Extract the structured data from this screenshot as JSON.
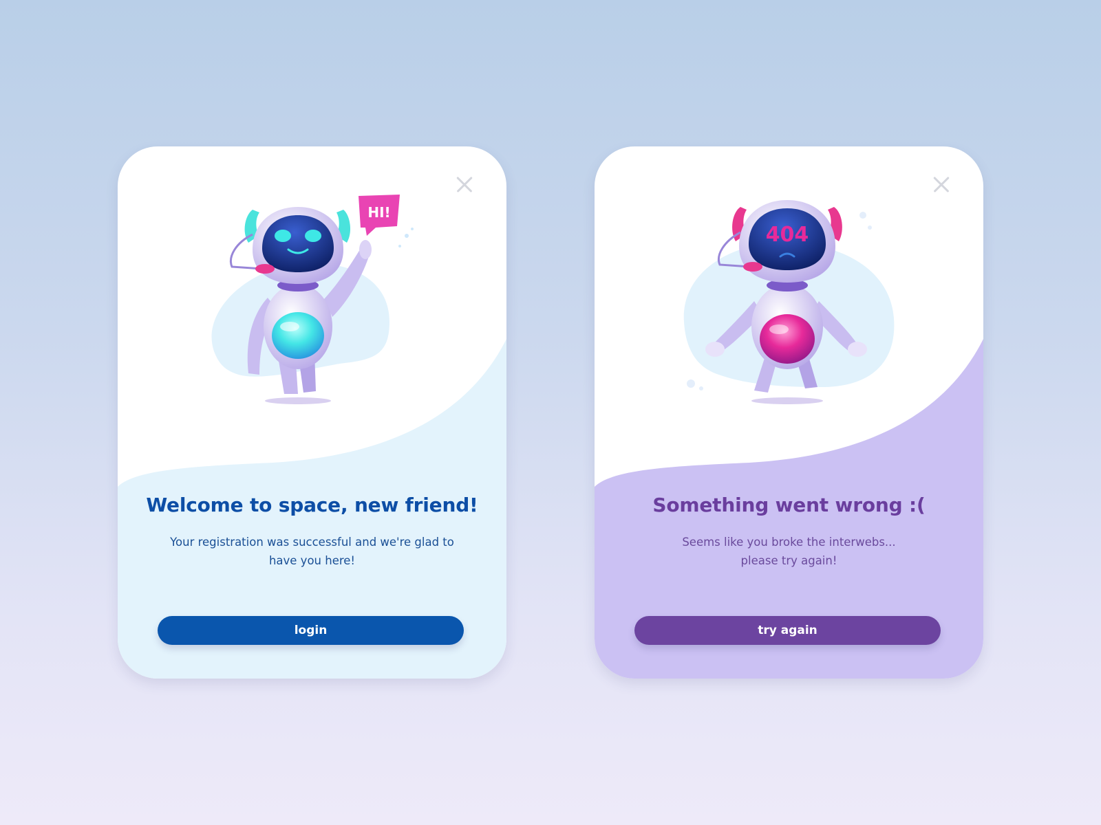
{
  "cards": [
    {
      "id": "success",
      "speech_bubble": "HI!",
      "title": "Welcome to space, new friend!",
      "message": "Your registration was successful and we're glad to\nhave you here!",
      "button_label": "login",
      "close_icon": "close-icon",
      "colors": {
        "title": "#0d4ea6",
        "message": "#1a4f95",
        "button": "#0a56ad",
        "wave": "#e3f3fc",
        "accent": "#3ee8e6"
      }
    },
    {
      "id": "error",
      "screen_text": "404",
      "title": "Something went wrong :(",
      "message": "Seems like you broke the interwebs...\nplease try again!",
      "button_label": "try again",
      "close_icon": "close-icon",
      "colors": {
        "title": "#6a3e9e",
        "message": "#6a4a9c",
        "button": "#6c44a0",
        "wave": "#cbc1f3",
        "accent": "#e72a9a"
      }
    }
  ]
}
